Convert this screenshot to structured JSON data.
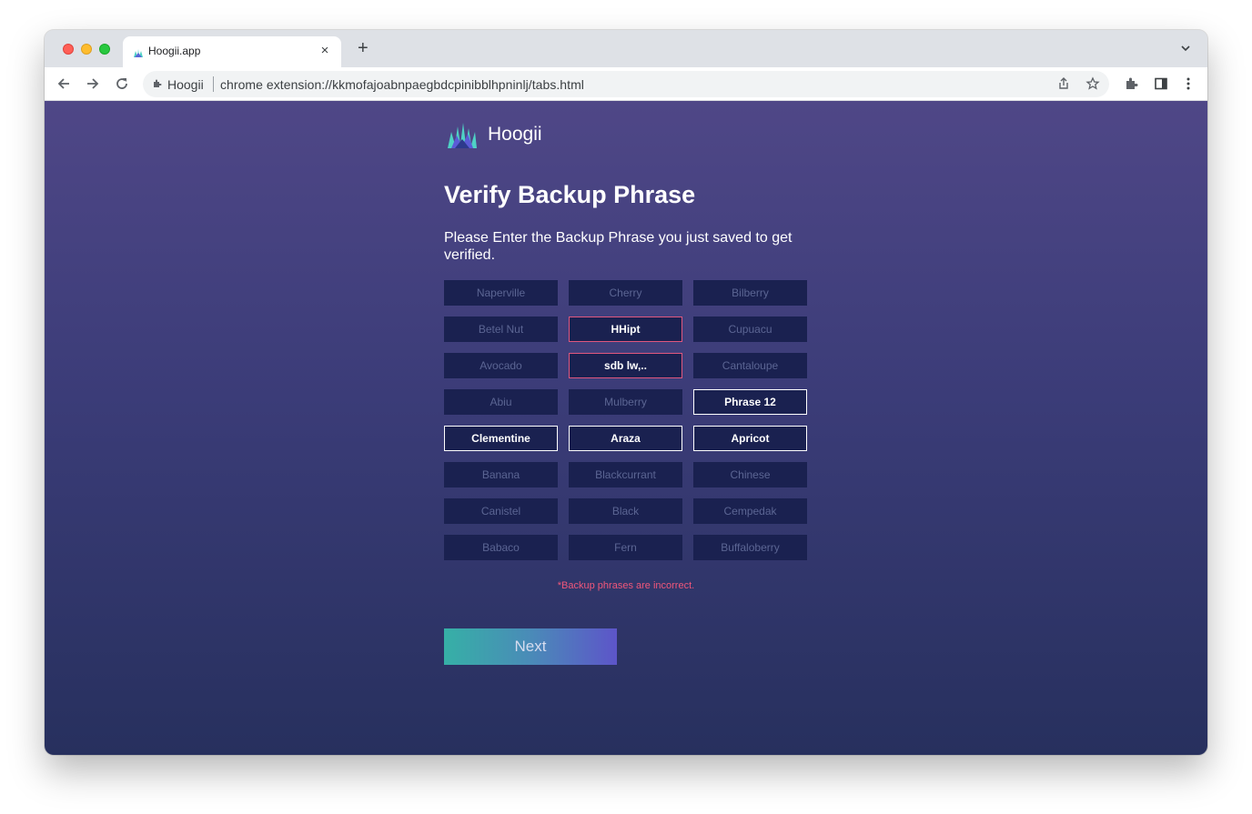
{
  "browser": {
    "tab_title": "Hoogii.app",
    "tab_close": "×",
    "new_tab": "+",
    "omnibox_site": "Hoogii",
    "omnibox_url": "chrome extension://kkmofajoabnpaegbdcpinibblhpninlj/tabs.html"
  },
  "page": {
    "brand_name": "Hoogii",
    "heading": "Verify Backup Phrase",
    "subtext": "Please Enter the Backup Phrase you just saved to get verified.",
    "words": [
      {
        "label": "Naperville",
        "state": "default"
      },
      {
        "label": "Cherry",
        "state": "default"
      },
      {
        "label": "Bilberry",
        "state": "default"
      },
      {
        "label": "Betel Nut",
        "state": "default"
      },
      {
        "label": "HHipt",
        "state": "error"
      },
      {
        "label": "Cupuacu",
        "state": "default"
      },
      {
        "label": "Avocado",
        "state": "default"
      },
      {
        "label": "sdb lw,..",
        "state": "error"
      },
      {
        "label": "Cantaloupe",
        "state": "default"
      },
      {
        "label": "Abiu",
        "state": "default"
      },
      {
        "label": "Mulberry",
        "state": "default"
      },
      {
        "label": "Phrase 12",
        "state": "selected"
      },
      {
        "label": "Clementine",
        "state": "selected"
      },
      {
        "label": "Araza",
        "state": "selected"
      },
      {
        "label": "Apricot",
        "state": "selected"
      },
      {
        "label": "Banana",
        "state": "default"
      },
      {
        "label": "Blackcurrant",
        "state": "default"
      },
      {
        "label": "Chinese",
        "state": "default"
      },
      {
        "label": "Canistel",
        "state": "default"
      },
      {
        "label": "Black",
        "state": "default"
      },
      {
        "label": "Cempedak",
        "state": "default"
      },
      {
        "label": "Babaco",
        "state": "default"
      },
      {
        "label": "Fern",
        "state": "default"
      },
      {
        "label": "Buffaloberry",
        "state": "default"
      }
    ],
    "error_message": "*Backup phrases are incorrect.",
    "next_label": "Next"
  },
  "colors": {
    "accent_error": "#e0577e",
    "chip_bg": "#1a2150",
    "button_gradient_start": "#36b0a6",
    "button_gradient_end": "#5d55c9"
  }
}
